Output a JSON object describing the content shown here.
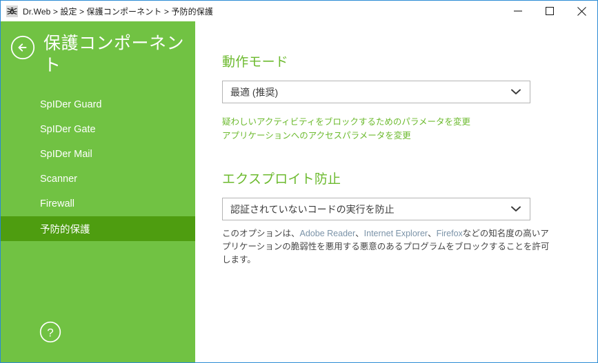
{
  "window": {
    "app_icon": "spider-icon",
    "breadcrumb": "Dr.Web > 設定 > 保護コンポーネント > 予防的保護",
    "controls": {
      "minimize": "minimize-icon",
      "maximize": "maximize-icon",
      "close": "close-icon"
    },
    "border_color": "#2a8ad4"
  },
  "sidebar": {
    "background_color": "#71c243",
    "selected_color": "#4e9d10",
    "back_icon": "back-arrow-icon",
    "title": "保護コンポーネント",
    "items": [
      {
        "label": "SpIDer Guard",
        "selected": false
      },
      {
        "label": "SpIDer Gate",
        "selected": false
      },
      {
        "label": "SpIDer Mail",
        "selected": false
      },
      {
        "label": "Scanner",
        "selected": false
      },
      {
        "label": "Firewall",
        "selected": false
      },
      {
        "label": "予防的保護",
        "selected": true
      }
    ],
    "help_icon": "help-question-icon"
  },
  "main": {
    "accent_color": "#6cba2e",
    "operation_mode": {
      "heading": "動作モード",
      "select_value": "最適 (推奨)",
      "links": [
        "疑わしいアクティビティをブロックするためのパラメータを変更",
        "アプリケーションへのアクセスパラメータを変更"
      ]
    },
    "exploit_prevention": {
      "heading": "エクスプロイト防止",
      "select_value": "認証されていないコードの実行を防止",
      "description_parts": {
        "p1": "このオプションは、",
        "app1": "Adobe Reader",
        "sep1": "、",
        "app2": "Internet Explorer",
        "sep2": "、",
        "app3": "Firefox",
        "p2": "などの知名度の高いアプリケーションの脆弱性を悪用する悪意のあるプログラムをブロックすることを許可します。"
      }
    }
  }
}
